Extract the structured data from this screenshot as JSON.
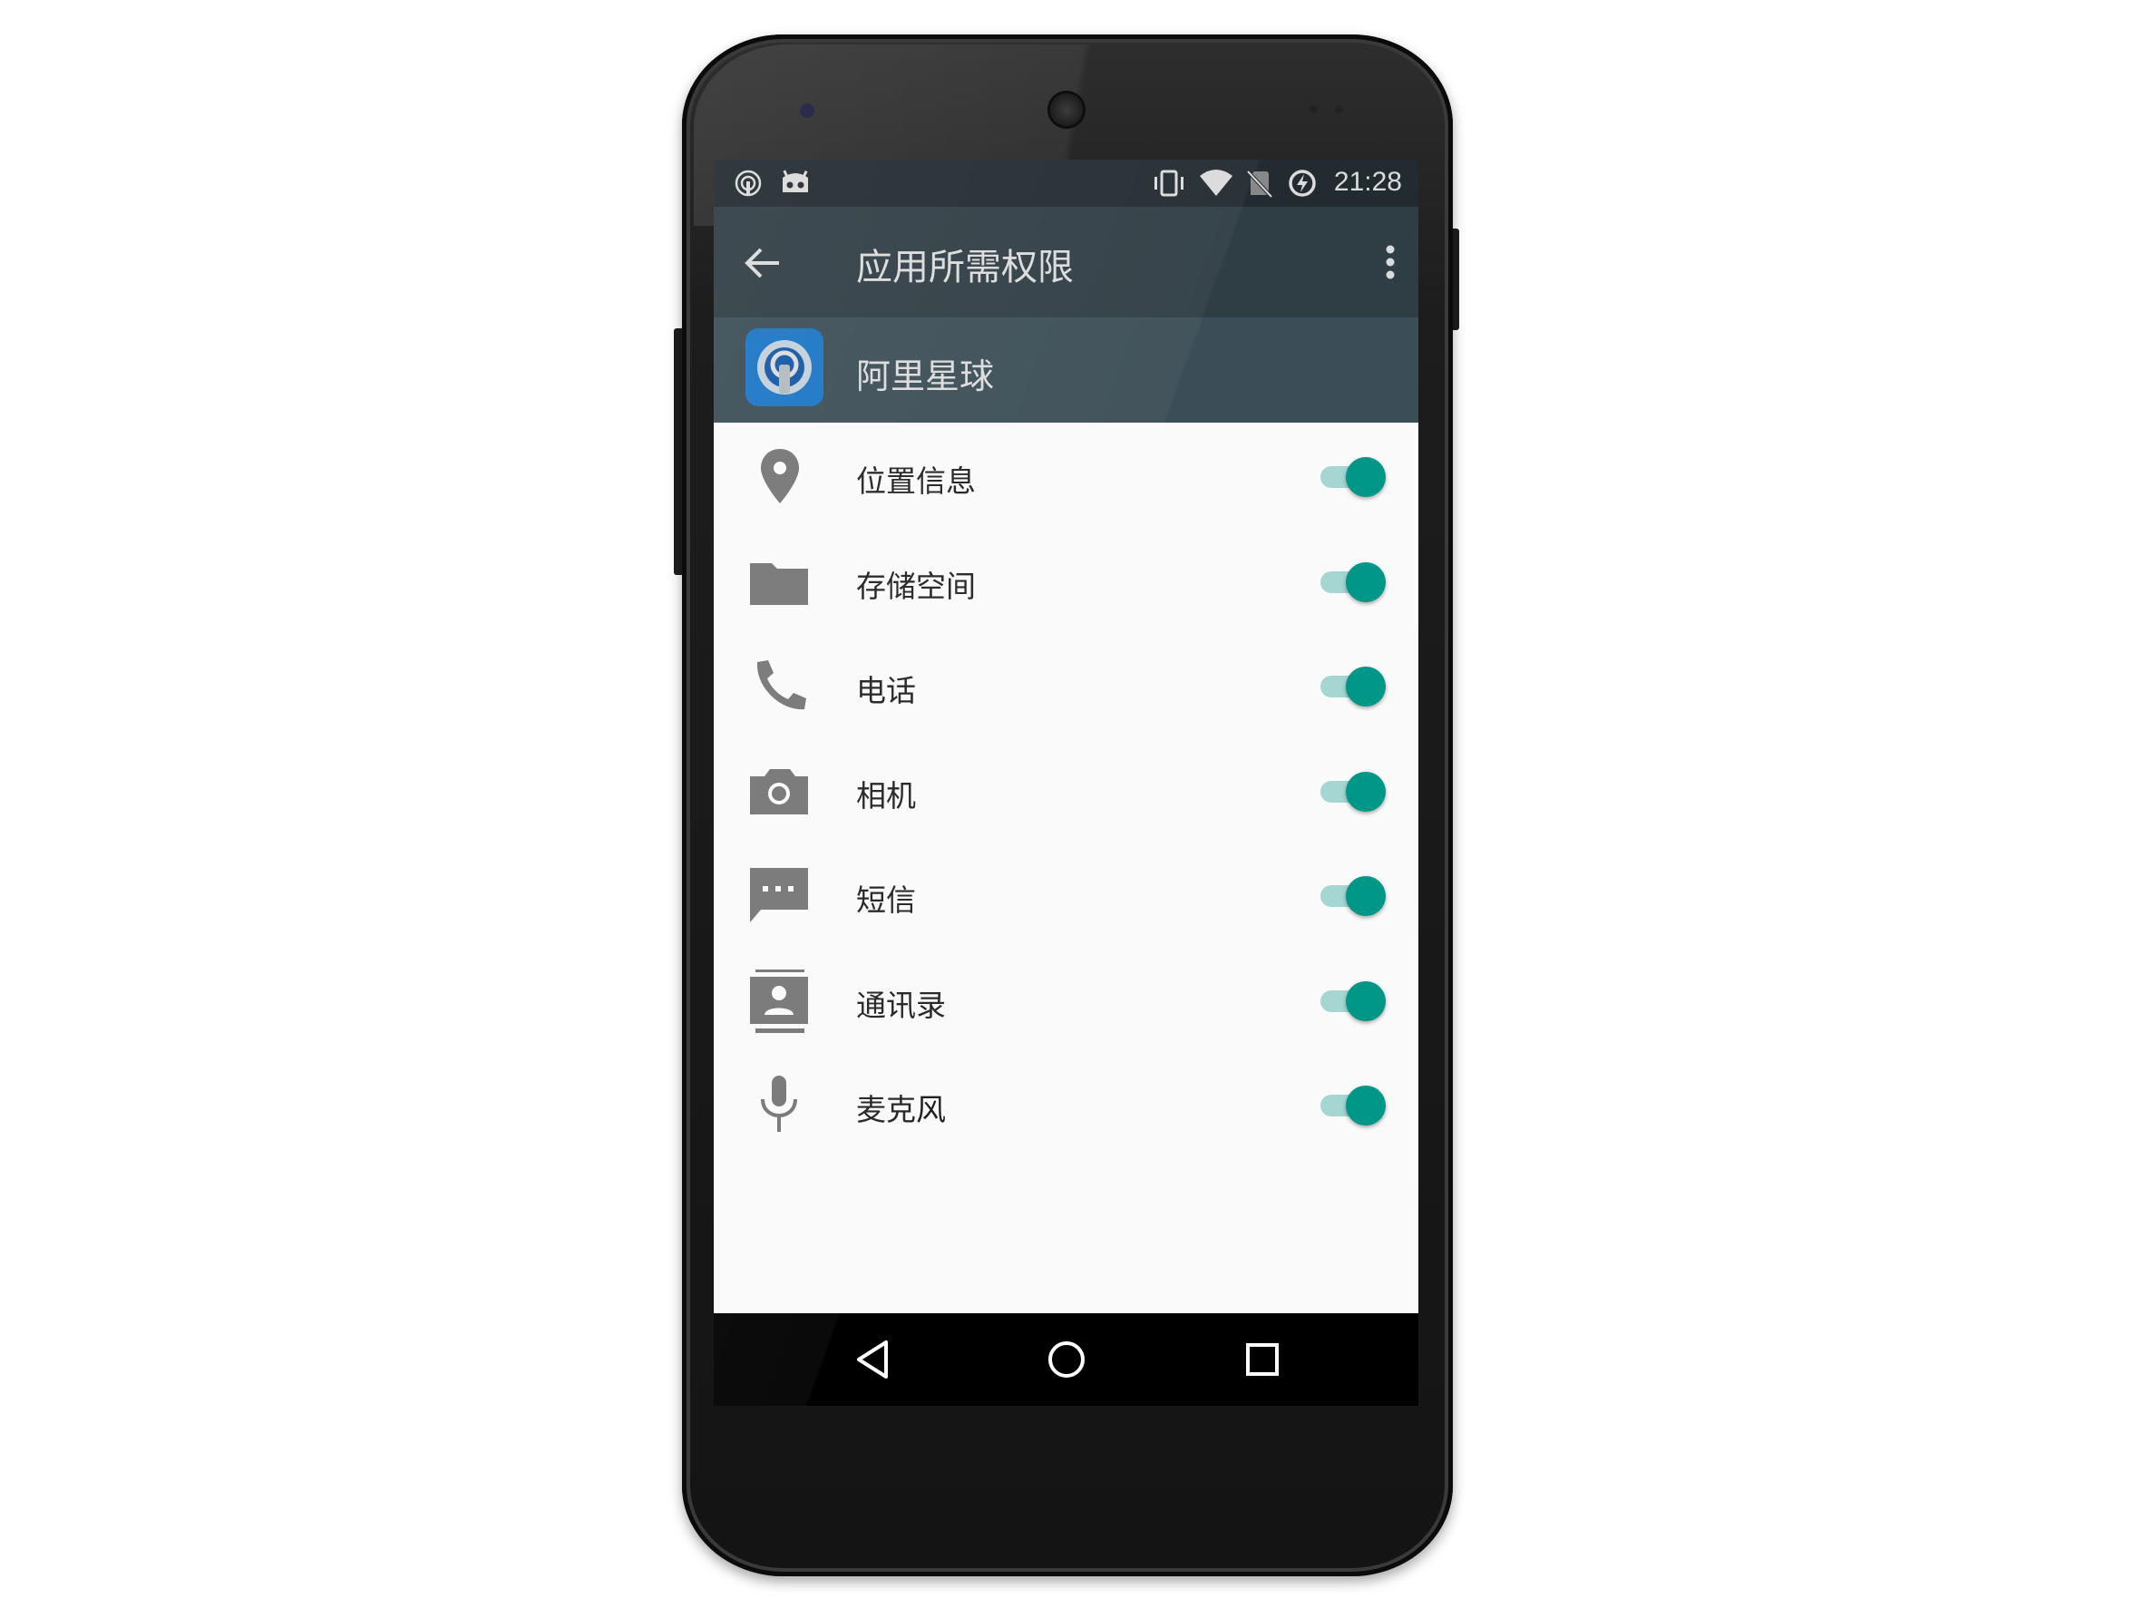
{
  "status_bar": {
    "time": "21:28",
    "icons": [
      "podcast-icon",
      "android-debug-icon",
      "vibrate-icon",
      "wifi-icon",
      "no-sim-icon",
      "data-saver-icon"
    ]
  },
  "toolbar": {
    "title": "应用所需权限",
    "back_icon": "arrow-back-icon",
    "menu_icon": "more-vert-icon"
  },
  "app": {
    "name": "阿里星球",
    "icon": "ali-planet-app-icon"
  },
  "permissions": [
    {
      "label": "位置信息",
      "icon": "location-pin-icon",
      "enabled": true
    },
    {
      "label": "存储空间",
      "icon": "folder-icon",
      "enabled": true
    },
    {
      "label": "电话",
      "icon": "phone-icon",
      "enabled": true
    },
    {
      "label": "相机",
      "icon": "camera-icon",
      "enabled": true
    },
    {
      "label": "短信",
      "icon": "sms-icon",
      "enabled": true
    },
    {
      "label": "通讯录",
      "icon": "contacts-icon",
      "enabled": true
    },
    {
      "label": "麦克风",
      "icon": "microphone-icon",
      "enabled": true
    }
  ],
  "nav_bar": {
    "buttons": [
      "back-triangle-icon",
      "home-circle-icon",
      "recents-square-icon"
    ]
  },
  "colors": {
    "status_bar": "#263238",
    "toolbar": "#37474f",
    "app_header": "#455a64",
    "switch_on": "#009688",
    "switch_track": "#a5d6d2",
    "icon_gray": "#757575"
  }
}
